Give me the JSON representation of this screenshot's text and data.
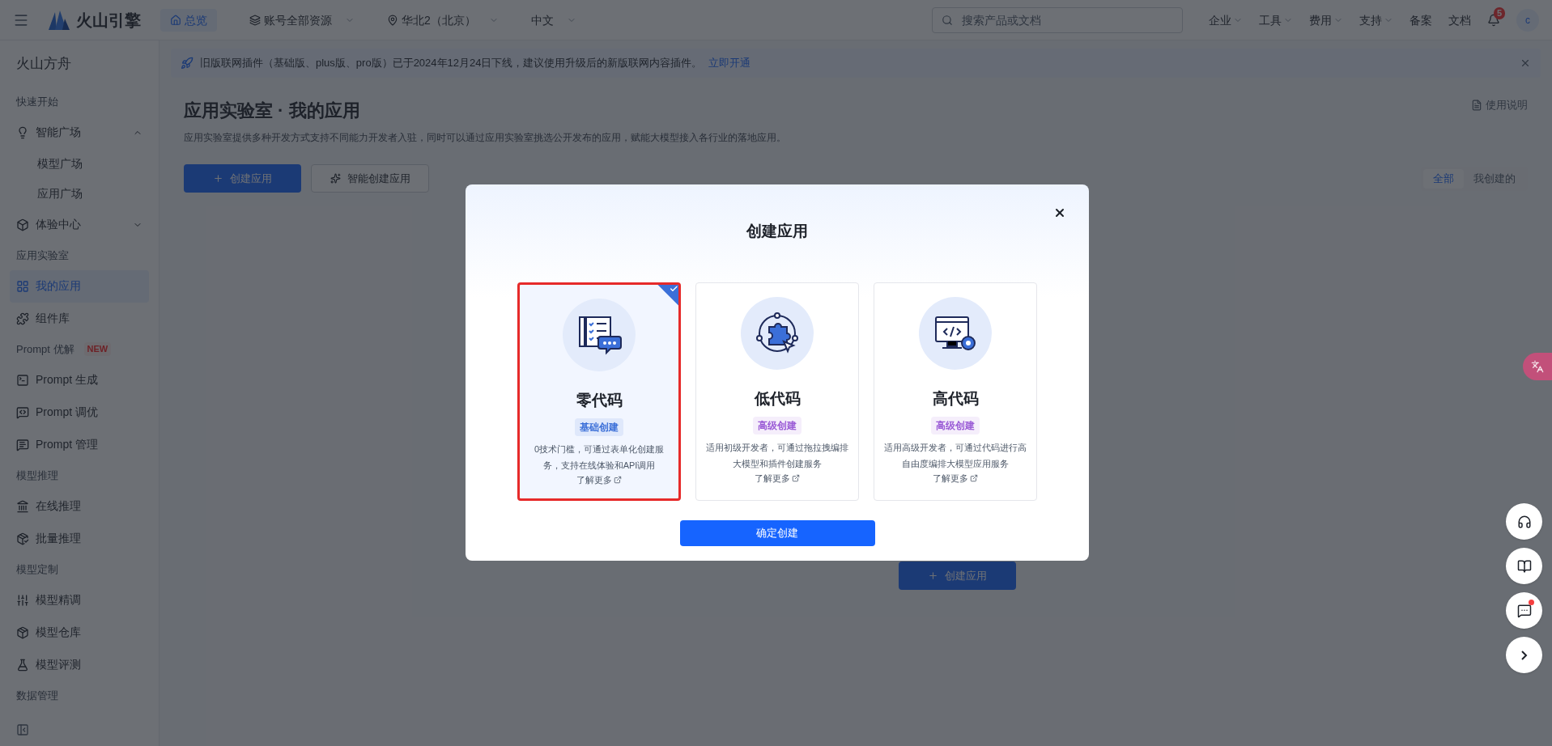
{
  "top_bar": {
    "logo": "火山引擎",
    "home_tab": {
      "label": "总览",
      "selected": true
    },
    "selectors": [
      "账号全部资源",
      "华北2（北京）",
      "中文"
    ],
    "search": {
      "placeholder": "搜索产品或文档"
    },
    "menus": [
      {
        "label": "企业",
        "dropdown": true
      },
      {
        "label": "工具",
        "dropdown": true
      },
      {
        "label": "费用",
        "dropdown": true
      },
      {
        "label": "支持",
        "dropdown": true
      },
      {
        "label": "备案",
        "dropdown": false
      },
      {
        "label": "文档",
        "dropdown": false
      }
    ],
    "notifications": "5",
    "avatar": "c"
  },
  "sidebar": {
    "title": "火山方舟",
    "items": [
      {
        "kind": "section",
        "label": "快速开始"
      },
      {
        "kind": "item",
        "label": "智能广场",
        "selected": false,
        "expanded": true,
        "children": [
          {
            "label": "模型广场",
            "selected": false
          },
          {
            "label": "应用广场",
            "selected": false
          }
        ]
      },
      {
        "kind": "item",
        "label": "体验中心",
        "selected": false,
        "expanded": false
      },
      {
        "kind": "section",
        "label": "应用实验室"
      },
      {
        "kind": "item",
        "label": "我的应用",
        "selected": true
      },
      {
        "kind": "item",
        "label": "组件库",
        "selected": false
      },
      {
        "kind": "section",
        "label": "Prompt 优解",
        "badge": "NEW"
      },
      {
        "kind": "item",
        "label": "Prompt 生成",
        "selected": false
      },
      {
        "kind": "item",
        "label": "Prompt 调优",
        "selected": false
      },
      {
        "kind": "item",
        "label": "Prompt 管理",
        "selected": false
      },
      {
        "kind": "section",
        "label": "模型推理"
      },
      {
        "kind": "item",
        "label": "在线推理",
        "selected": false
      },
      {
        "kind": "item",
        "label": "批量推理",
        "selected": false
      },
      {
        "kind": "section",
        "label": "模型定制"
      },
      {
        "kind": "item",
        "label": "模型精调",
        "selected": false
      },
      {
        "kind": "item",
        "label": "模型仓库",
        "selected": false
      },
      {
        "kind": "item",
        "label": "模型评测",
        "selected": false
      },
      {
        "kind": "section",
        "label": "数据管理"
      }
    ]
  },
  "banner": {
    "text": "旧版联网插件（基础版、plus版、pro版）已于2024年12月24日下线，建议使用升级后的新版联网内容插件。",
    "link": "立即开通"
  },
  "page": {
    "title": "应用实验室 · 我的应用",
    "description": "应用实验室提供多种开发方式支持不同能力开发者入驻，同时可以通过应用实验室挑选公开发布的应用，赋能大模型接入各行业的落地应用。",
    "help_link": "使用说明",
    "buttons": [
      "创建应用",
      "智能创建应用"
    ],
    "filter_tabs": [
      {
        "label": "全部",
        "selected": true
      },
      {
        "label": "我创建的",
        "selected": false
      }
    ],
    "empty_button": "创建应用"
  },
  "dialog": {
    "title": "创建应用",
    "options": [
      {
        "kind": "form",
        "title": "零代码",
        "tag": "基础创建",
        "color": "#3b6fd8",
        "description": "0技术门槛，可通过表单化创建服务，支持在线体验和API调用",
        "link": "了解更多",
        "selected": true
      },
      {
        "kind": "puzzle",
        "title": "低代码",
        "tag": "高级创建",
        "color": "#9a5bd6",
        "description": "适用初级开发者，可通过拖拉拽编排大模型和插件创建服务",
        "link": "了解更多",
        "selected": false
      },
      {
        "kind": "code",
        "title": "高代码",
        "tag": "高级创建",
        "color": "#9a5bd6",
        "description": "适用高级开发者，可通过代码进行高自由度编排大模型应用服务",
        "link": "了解更多",
        "selected": false
      }
    ],
    "confirm": "确定创建"
  },
  "floating_buttons": [
    {
      "kind": "support",
      "dot": false
    },
    {
      "kind": "docs",
      "dot": false
    },
    {
      "kind": "message",
      "dot": true
    },
    {
      "kind": "expand",
      "dot": false
    }
  ]
}
